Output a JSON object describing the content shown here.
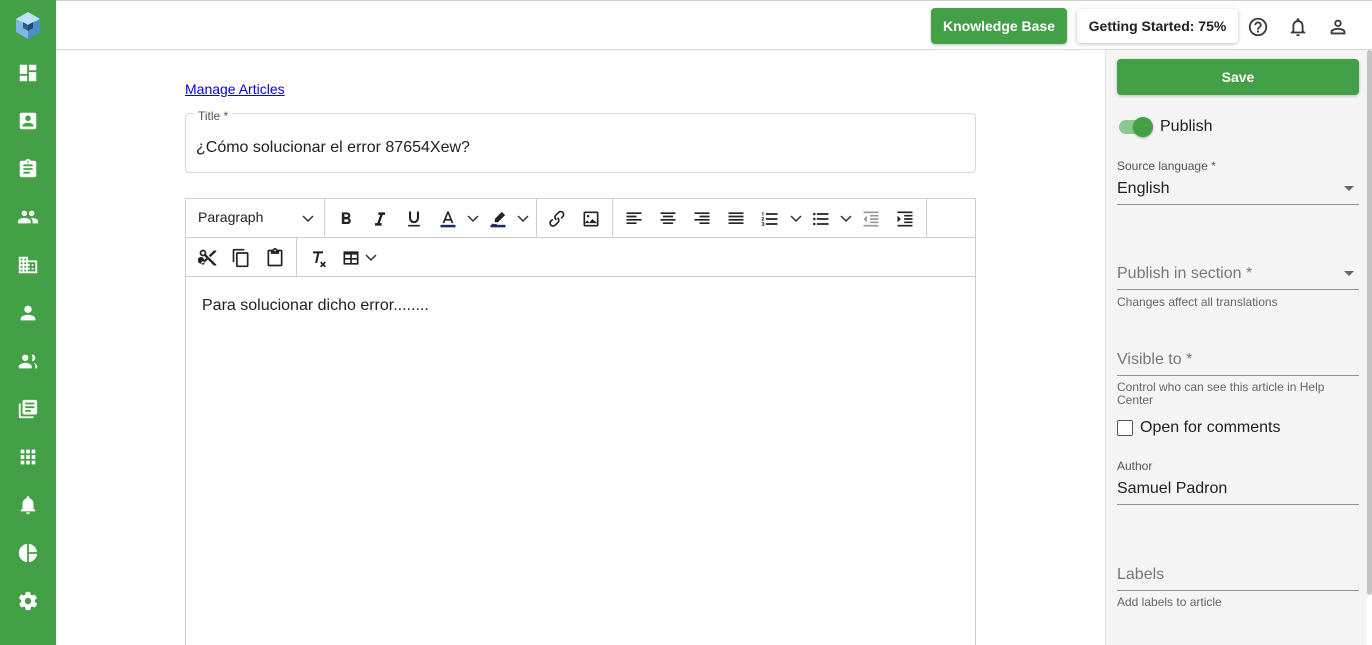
{
  "topbar": {
    "knowledge_base_label": "Knowledge Base",
    "getting_started_label": "Getting Started: 75%"
  },
  "sidebar": {
    "items": [
      "dashboard",
      "contacts",
      "tasks",
      "customers",
      "organizations",
      "users",
      "groups",
      "articles",
      "apps",
      "notifications",
      "reports",
      "settings"
    ]
  },
  "main": {
    "manage_articles_link": "Manage Articles",
    "title_label": "Title *",
    "title_value": "¿Cómo solucionar el error 87654Xew?",
    "editor": {
      "paragraph_select": "Paragraph",
      "body_text": "Para solucionar dicho error........"
    }
  },
  "panel": {
    "save_label": "Save",
    "publish_label": "Publish",
    "publish_on": true,
    "source_language_label": "Source language *",
    "source_language_value": "English",
    "publish_section_placeholder": "Publish in section *",
    "publish_section_help": "Changes affect all translations",
    "visible_to_placeholder": "Visible to *",
    "visible_to_help": "Control who can see this article in Help Center",
    "open_comments_label": "Open for comments",
    "open_comments_checked": false,
    "author_label": "Author",
    "author_value": "Samuel Padron",
    "labels_placeholder": "Labels",
    "labels_help": "Add labels to article"
  },
  "colors": {
    "brand_green": "#43a047",
    "toggle_track": "#8ccb8f"
  }
}
